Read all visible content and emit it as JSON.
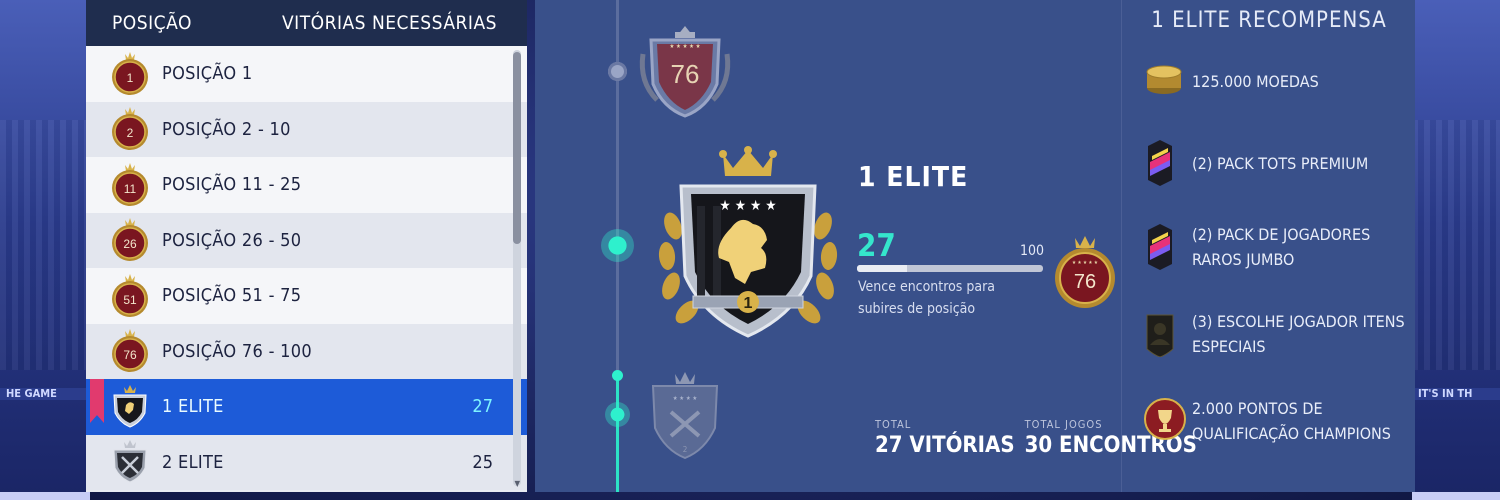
{
  "ranking": {
    "header": {
      "position_label": "POSIÇÃO",
      "wins_label": "VITÓRIAS NECESSÁRIAS"
    },
    "rows": [
      {
        "badge": "1",
        "label": "POSIÇÃO 1",
        "wins": "",
        "badge_type": "red"
      },
      {
        "badge": "2",
        "label": "POSIÇÃO 2 - 10",
        "wins": "",
        "badge_type": "red"
      },
      {
        "badge": "11",
        "label": "POSIÇÃO 11 - 25",
        "wins": "",
        "badge_type": "red"
      },
      {
        "badge": "26",
        "label": "POSIÇÃO 26 - 50",
        "wins": "",
        "badge_type": "red"
      },
      {
        "badge": "51",
        "label": "POSIÇÃO 51 - 75",
        "wins": "",
        "badge_type": "red"
      },
      {
        "badge": "76",
        "label": "POSIÇÃO 76 - 100",
        "wins": "",
        "badge_type": "red"
      },
      {
        "badge": "",
        "label": "1 ELITE",
        "wins": "27",
        "badge_type": "elite1",
        "selected": true
      },
      {
        "badge": "",
        "label": "2 ELITE",
        "wins": "25",
        "badge_type": "elite2"
      }
    ]
  },
  "detail": {
    "prev_badge_number": "76",
    "elite_title": "1 ELITE",
    "current_wins": "27",
    "target_number": "100",
    "target_badge_number": "76",
    "progress_fraction": 0.27,
    "progress_desc": "Vence encontros para subires de posição",
    "elite_badge_number": "1",
    "totals": [
      {
        "caption": "TOTAL",
        "value": "27 VITÓRIAS"
      },
      {
        "caption": "TOTAL JOGOS",
        "value": "30 ENCONTROS"
      }
    ]
  },
  "rewards": {
    "title": "1 ELITE RECOMPENSA",
    "items": [
      {
        "icon": "coins-icon",
        "text": "125.000 MOEDAS"
      },
      {
        "icon": "pack-icon",
        "text": "(2) PACK TOTS PREMIUM"
      },
      {
        "icon": "pack-icon",
        "text": "(2) PACK DE JOGADORES RAROS JUMBO"
      },
      {
        "icon": "player-pick-icon",
        "text": "(3) ESCOLHE JOGADOR ITENS ESPECIAIS"
      },
      {
        "icon": "trophy-icon",
        "text": "2.000 PONTOS DE QUALIFICAÇÃO CHAMPIONS"
      }
    ]
  },
  "colors": {
    "accent_teal": "#35e6cc",
    "selected_row": "#1d5bd8",
    "panel_bg": "#39508a",
    "header_bg": "#1f2d4e",
    "badge_red": "#7a1620",
    "gold": "#d8b24a"
  },
  "background": {
    "left_banner_text": "HE GAME",
    "right_banner_text": "IT'S IN TH"
  }
}
